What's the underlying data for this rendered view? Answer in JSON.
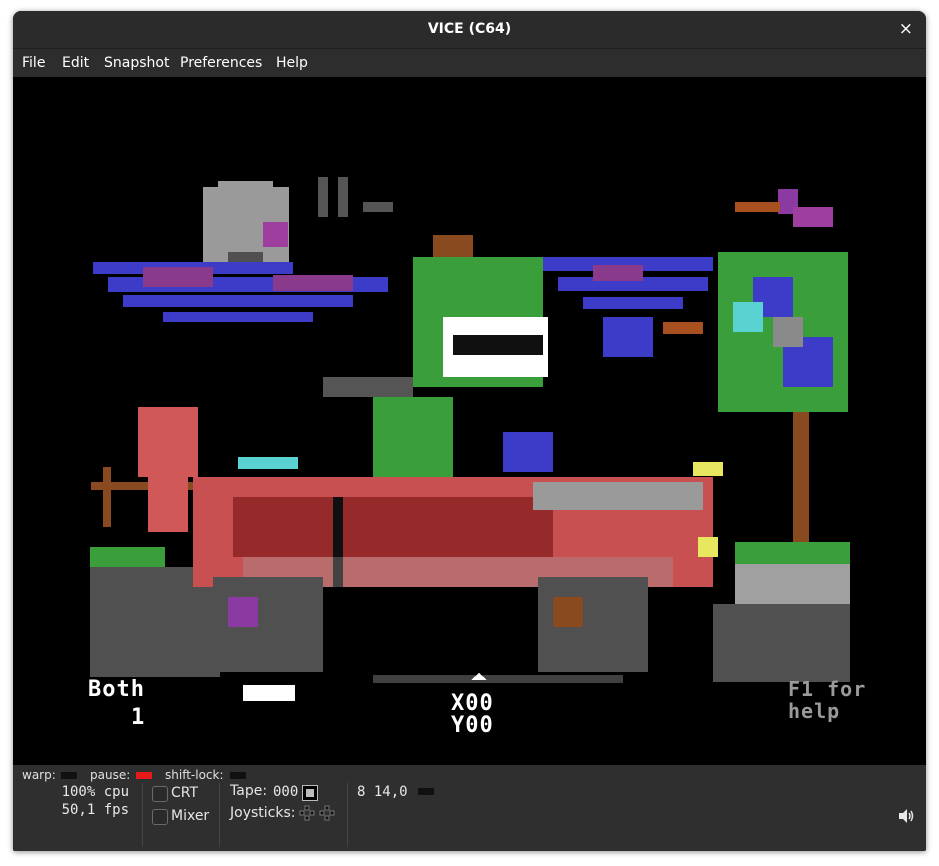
{
  "window": {
    "title": "VICE (C64)",
    "close_glyph": "×",
    "close_icon": "close-icon"
  },
  "menu": [
    {
      "label": "File"
    },
    {
      "label": "Edit"
    },
    {
      "label": "Snapshot"
    },
    {
      "label": "Preferences"
    },
    {
      "label": "Help"
    }
  ],
  "game_screen": {
    "left_label_line1": "Both",
    "left_label_line2": "1",
    "center_line1": "X00",
    "center_line2": "Y00",
    "right_line1": "F1 for",
    "right_line2": "help"
  },
  "status": {
    "warp_label": "warp:",
    "pause_label": "pause:",
    "shift_lock_label": "shift-lock:",
    "cpu": "100% cpu",
    "fps": "50,1 fps",
    "crt_label": "CRT",
    "mixer_label": "Mixer",
    "tape_label": "Tape:",
    "tape_counter": "000",
    "joysticks_label": "Joysticks:",
    "drive": "8 14,0",
    "volume_icon": "speaker-icon",
    "colors": {
      "pause_led": "#e51a1a",
      "led_off": "#111111"
    }
  }
}
